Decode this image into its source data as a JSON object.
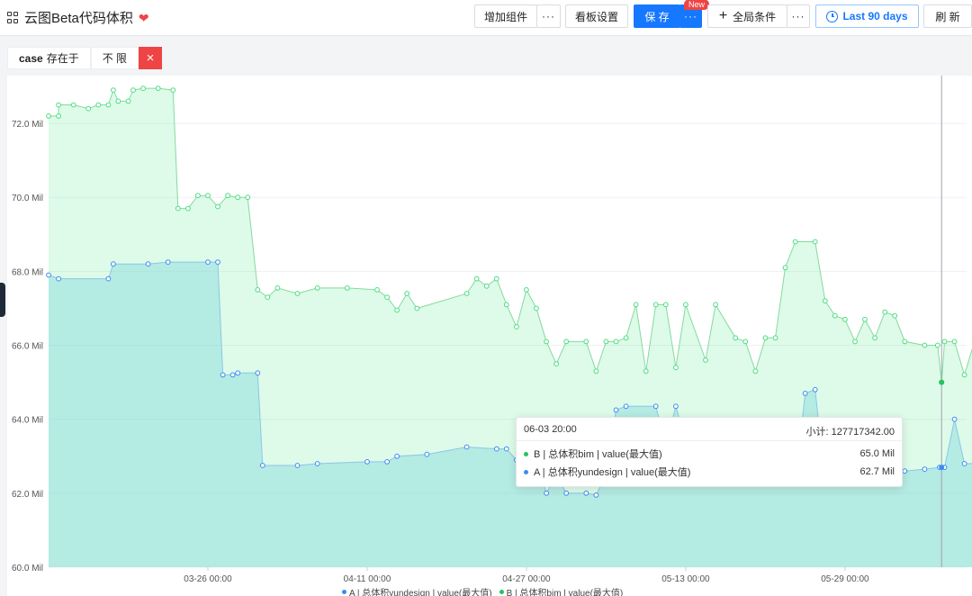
{
  "header": {
    "title": "云图Beta代码体积",
    "add_widget": "增加组件",
    "more": "···",
    "board_settings": "看板设置",
    "save": "保 存",
    "new_badge": "New",
    "global_conditions": "全局条件",
    "date_range": "Last 90 days",
    "refresh": "刷 新",
    "icons": [
      "grid-icon",
      "heart-icon",
      "plus-icon",
      "clock-icon"
    ]
  },
  "filter": {
    "field": "case",
    "operator": "存在于",
    "value": "不 限",
    "remove": "×"
  },
  "tooltip": {
    "time": "06-03 20:00",
    "subtotal": "小计: 127717342.00",
    "rows": [
      {
        "label": "B | 总体积bim | value(最大值)",
        "value": "65.0 Mil",
        "color": "#22c55e"
      },
      {
        "label": "A | 总体积yundesign | value(最大值)",
        "value": "62.7 Mil",
        "color": "#3b8cf0"
      }
    ]
  },
  "legend": [
    {
      "label": "A | 总体积yundesign | value(最大值)",
      "color": "#3b8cf0"
    },
    {
      "label": "B | 总体积bim | value(最大值)",
      "color": "#22c55e"
    }
  ],
  "colors": {
    "accent": "#1677ff",
    "danger": "#ef4444",
    "series_a": "#3b8cf0",
    "series_b": "#4ade80"
  },
  "chart_data": {
    "type": "area",
    "x_tick_labels": [
      "03-26 00:00",
      "04-11 00:00",
      "04-27 00:00",
      "05-13 00:00",
      "05-29 00:00"
    ],
    "y_tick_labels": [
      "60.0 Mil",
      "62.0 Mil",
      "64.0 Mil",
      "66.0 Mil",
      "68.0 Mil",
      "70.0 Mil",
      "72.0 Mil"
    ],
    "ylim": [
      60,
      73
    ],
    "x_unit": "days since 03-11 00:00",
    "xlim": [
      0,
      90
    ],
    "grid": true,
    "legend_position": "bottom",
    "series": [
      {
        "name": "B | 总体积bim | value(最大值)",
        "points": [
          [
            0,
            72.2
          ],
          [
            1,
            72.2
          ],
          [
            1,
            72.5
          ],
          [
            2.5,
            72.5
          ],
          [
            4,
            72.4
          ],
          [
            5,
            72.5
          ],
          [
            6,
            72.5
          ],
          [
            6.5,
            72.9
          ],
          [
            7,
            72.6
          ],
          [
            8,
            72.6
          ],
          [
            8.5,
            72.9
          ],
          [
            9.5,
            72.95
          ],
          [
            11,
            72.95
          ],
          [
            12.5,
            72.9
          ],
          [
            13,
            69.7
          ],
          [
            14,
            69.7
          ],
          [
            15,
            70.05
          ],
          [
            16,
            70.05
          ],
          [
            17,
            69.75
          ],
          [
            18,
            70.05
          ],
          [
            19,
            70.0
          ],
          [
            20,
            70.0
          ],
          [
            21,
            67.5
          ],
          [
            22,
            67.3
          ],
          [
            23,
            67.55
          ],
          [
            25,
            67.4
          ],
          [
            27,
            67.55
          ],
          [
            30,
            67.55
          ],
          [
            33,
            67.5
          ],
          [
            34,
            67.3
          ],
          [
            35,
            66.95
          ],
          [
            36,
            67.4
          ],
          [
            37,
            67.0
          ],
          [
            42,
            67.4
          ],
          [
            43,
            67.8
          ],
          [
            44,
            67.6
          ],
          [
            45,
            67.8
          ],
          [
            46,
            67.1
          ],
          [
            47,
            66.5
          ],
          [
            48,
            67.5
          ],
          [
            49,
            67.0
          ],
          [
            50,
            66.1
          ],
          [
            51,
            65.5
          ],
          [
            52,
            66.1
          ],
          [
            54,
            66.1
          ],
          [
            55,
            65.3
          ],
          [
            56,
            66.1
          ],
          [
            57,
            66.1
          ],
          [
            58,
            66.2
          ],
          [
            59,
            67.1
          ],
          [
            60,
            65.3
          ],
          [
            61,
            67.1
          ],
          [
            62,
            67.1
          ],
          [
            63,
            65.4
          ],
          [
            64,
            67.1
          ],
          [
            66,
            65.6
          ],
          [
            67,
            67.1
          ],
          [
            69,
            66.2
          ],
          [
            70,
            66.1
          ],
          [
            71,
            65.3
          ],
          [
            72,
            66.2
          ],
          [
            73,
            66.2
          ],
          [
            74,
            68.1
          ],
          [
            75,
            68.8
          ],
          [
            77,
            68.8
          ],
          [
            78,
            67.2
          ],
          [
            79,
            66.8
          ],
          [
            80,
            66.7
          ],
          [
            81,
            66.1
          ],
          [
            82,
            66.7
          ],
          [
            83,
            66.2
          ],
          [
            84,
            66.9
          ],
          [
            85,
            66.8
          ],
          [
            86,
            66.1
          ],
          [
            88,
            66.0
          ],
          [
            89.3,
            66.0
          ],
          [
            89.7,
            65.0
          ],
          [
            90,
            66.1
          ],
          [
            91,
            66.1
          ],
          [
            92,
            65.2
          ],
          [
            93,
            66.1
          ]
        ]
      },
      {
        "name": "A | 总体积yundesign | value(最大值)",
        "points": [
          [
            0,
            67.9
          ],
          [
            1,
            67.8
          ],
          [
            6,
            67.8
          ],
          [
            6.5,
            68.2
          ],
          [
            10,
            68.2
          ],
          [
            12,
            68.25
          ],
          [
            16,
            68.25
          ],
          [
            17,
            68.25
          ],
          [
            17.5,
            65.2
          ],
          [
            18.5,
            65.2
          ],
          [
            19,
            65.25
          ],
          [
            21,
            65.25
          ],
          [
            21.5,
            62.75
          ],
          [
            25,
            62.75
          ],
          [
            27,
            62.8
          ],
          [
            32,
            62.85
          ],
          [
            34,
            62.85
          ],
          [
            35,
            63.0
          ],
          [
            38,
            63.05
          ],
          [
            42,
            63.25
          ],
          [
            45,
            63.2
          ],
          [
            46,
            63.2
          ],
          [
            47,
            62.9
          ],
          [
            48,
            62.5
          ],
          [
            49,
            62.9
          ],
          [
            50,
            62.0
          ],
          [
            51,
            62.5
          ],
          [
            52,
            62.0
          ],
          [
            54,
            62.0
          ],
          [
            55,
            61.95
          ],
          [
            56,
            62.5
          ],
          [
            57,
            64.25
          ],
          [
            58,
            64.35
          ],
          [
            61,
            64.35
          ],
          [
            62,
            63.3
          ],
          [
            63,
            64.35
          ],
          [
            65,
            62.5
          ],
          [
            67,
            62.3
          ],
          [
            70,
            62.3
          ],
          [
            72,
            62.3
          ],
          [
            74,
            62.3
          ],
          [
            75,
            62.3
          ],
          [
            76,
            64.7
          ],
          [
            77,
            64.8
          ],
          [
            78,
            62.3
          ],
          [
            80,
            62.5
          ],
          [
            84,
            62.5
          ],
          [
            86,
            62.6
          ],
          [
            88,
            62.65
          ],
          [
            89.5,
            62.7
          ],
          [
            90,
            62.7
          ],
          [
            91,
            64.0
          ],
          [
            92,
            62.8
          ],
          [
            93,
            62.8
          ]
        ]
      }
    ]
  }
}
